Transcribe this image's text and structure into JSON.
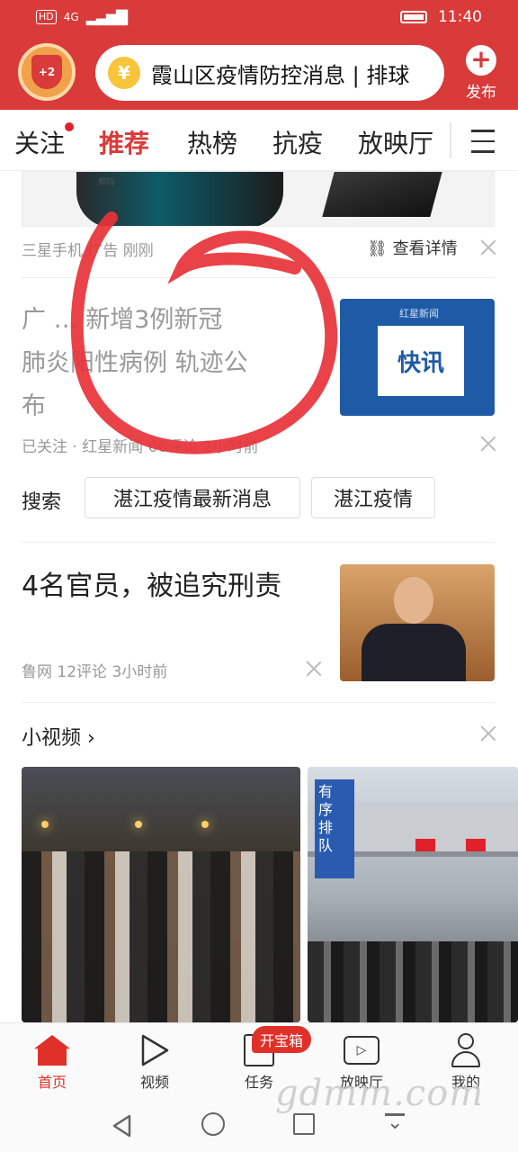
{
  "status_bar": {
    "left_badges": [
      "HD",
      "4G"
    ],
    "time": "11:40"
  },
  "header": {
    "avatar_badge": "+2",
    "search_text": "霞山区疫情防控消息 | 排球",
    "publish_label": "发布",
    "accent_color": "#d93a3a"
  },
  "tabs": [
    {
      "label": "关注",
      "dot": true
    },
    {
      "label": "推荐",
      "active": true
    },
    {
      "label": "热榜"
    },
    {
      "label": "抗疫"
    },
    {
      "label": "放映厅"
    }
  ],
  "feed": {
    "ad": {
      "caption": "郑钧",
      "source": "三星手机 广告  刚刚",
      "detail_label": "查看详情"
    },
    "article1": {
      "title_lines": [
        "广 …  新增3例新冠",
        "肺炎阳性病例 轨迹公",
        "布"
      ],
      "meta": "已关注 · 红星新闻 66评论 2小时前",
      "thumb_brand": "红星新闻",
      "thumb_label": "快讯"
    },
    "search": {
      "label": "搜索",
      "chips": [
        "湛江疫情最新消息",
        "湛江疫情"
      ]
    },
    "article2": {
      "title": "4名官员，被追究刑责",
      "meta": "鲁网  12评论  3小时前"
    },
    "short_video": {
      "title": "小视频 ›",
      "sign_text": "有 序 排 队"
    }
  },
  "bottom_nav": [
    {
      "label": "首页",
      "icon": "home-icon",
      "active": true
    },
    {
      "label": "视频",
      "icon": "play-icon"
    },
    {
      "label": "任务",
      "icon": "task-icon"
    },
    {
      "label": "放映厅",
      "icon": "tv-icon"
    },
    {
      "label": "我的",
      "icon": "user-icon"
    }
  ],
  "treasure_badge": "开宝箱",
  "watermark": "gdmm.com"
}
